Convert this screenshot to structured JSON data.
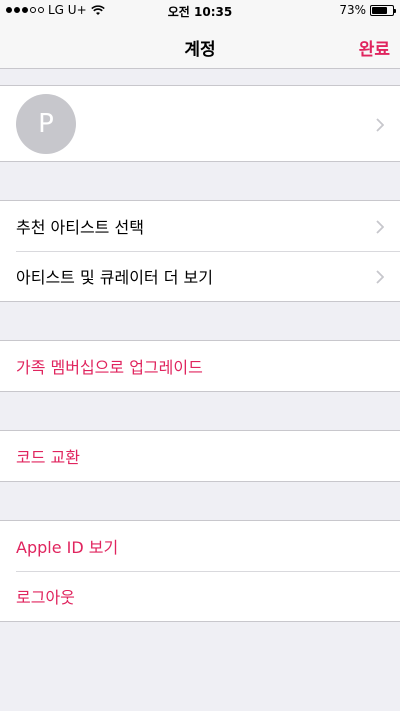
{
  "status_bar": {
    "carrier": "LG U+",
    "time": "오전 10:35",
    "battery": "73%",
    "battery_level": 0.73,
    "signal_bars_filled": 3,
    "signal_bars_total": 5
  },
  "nav": {
    "title": "계정",
    "done_label": "완료",
    "accent_color": "#e0245e"
  },
  "profile": {
    "avatar_initial": "P"
  },
  "section_artists": {
    "items": [
      {
        "label": "추천 아티스트 선택"
      },
      {
        "label": "아티스트 및 큐레이터 더 보기"
      }
    ]
  },
  "section_family": {
    "upgrade_label": "가족 멤버십으로 업그레이드"
  },
  "section_redeem": {
    "redeem_label": "코드 교환"
  },
  "section_account": {
    "view_apple_id_label": "Apple ID 보기",
    "logout_label": "로그아웃"
  }
}
